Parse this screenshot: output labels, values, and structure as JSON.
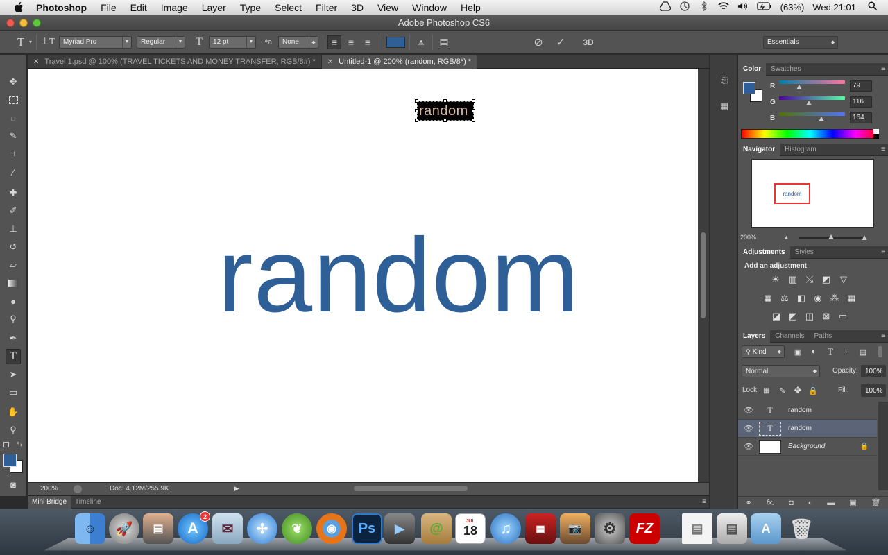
{
  "menubar": {
    "app_name": "Photoshop",
    "items": [
      "File",
      "Edit",
      "Image",
      "Layer",
      "Type",
      "Select",
      "Filter",
      "3D",
      "View",
      "Window",
      "Help"
    ],
    "battery": "(63%)",
    "clock": "Wed 21:01"
  },
  "window": {
    "title": "Adobe Photoshop CS6"
  },
  "options": {
    "font_family": "Myriad Pro",
    "font_style": "Regular",
    "font_size": "12 pt",
    "antialias": "None",
    "text_color": "#2e5f97",
    "workspace": "Essentials"
  },
  "tabs": [
    {
      "label": "Travel 1.psd @ 100% (TRAVEL TICKETS AND MONEY TRANSFER, RGB/8#) *"
    },
    {
      "label": "Untitled-1 @ 200% (random, RGB/8*) *"
    }
  ],
  "canvas": {
    "big_text": "random",
    "small_text": "random",
    "text_color": "#2e5f97"
  },
  "status": {
    "zoom": "200%",
    "doc": "Doc: 4.12M/255.9K"
  },
  "bottom_tabs": [
    "Mini Bridge",
    "Timeline"
  ],
  "color_panel": {
    "tabs": [
      "Color",
      "Swatches"
    ],
    "r_label": "R",
    "g_label": "G",
    "b_label": "B",
    "r": "79",
    "g": "116",
    "b": "164",
    "r_level": 0.31,
    "g_level": 0.455,
    "b_level": 0.643,
    "fg": "#2e5f97"
  },
  "navigator": {
    "tabs": [
      "Navigator",
      "Histogram"
    ],
    "zoom": "200%",
    "preview_text": "random"
  },
  "adjustments": {
    "tabs": [
      "Adjustments",
      "Styles"
    ],
    "title": "Add an adjustment"
  },
  "layers_panel": {
    "tabs": [
      "Layers",
      "Channels",
      "Paths"
    ],
    "filter": "Kind",
    "blend_mode": "Normal",
    "opacity_label": "Opacity:",
    "opacity": "100%",
    "lock_label": "Lock:",
    "fill_label": "Fill:",
    "fill": "100%",
    "layers": [
      {
        "name": "random",
        "type": "text"
      },
      {
        "name": "random",
        "type": "text"
      },
      {
        "name": "Background",
        "type": "bg"
      }
    ]
  },
  "dock": {
    "appstore_badge": "2",
    "calendar_month": "JUL",
    "calendar_day": "18",
    "ps_label": "Ps",
    "fz_label": "FZ"
  }
}
